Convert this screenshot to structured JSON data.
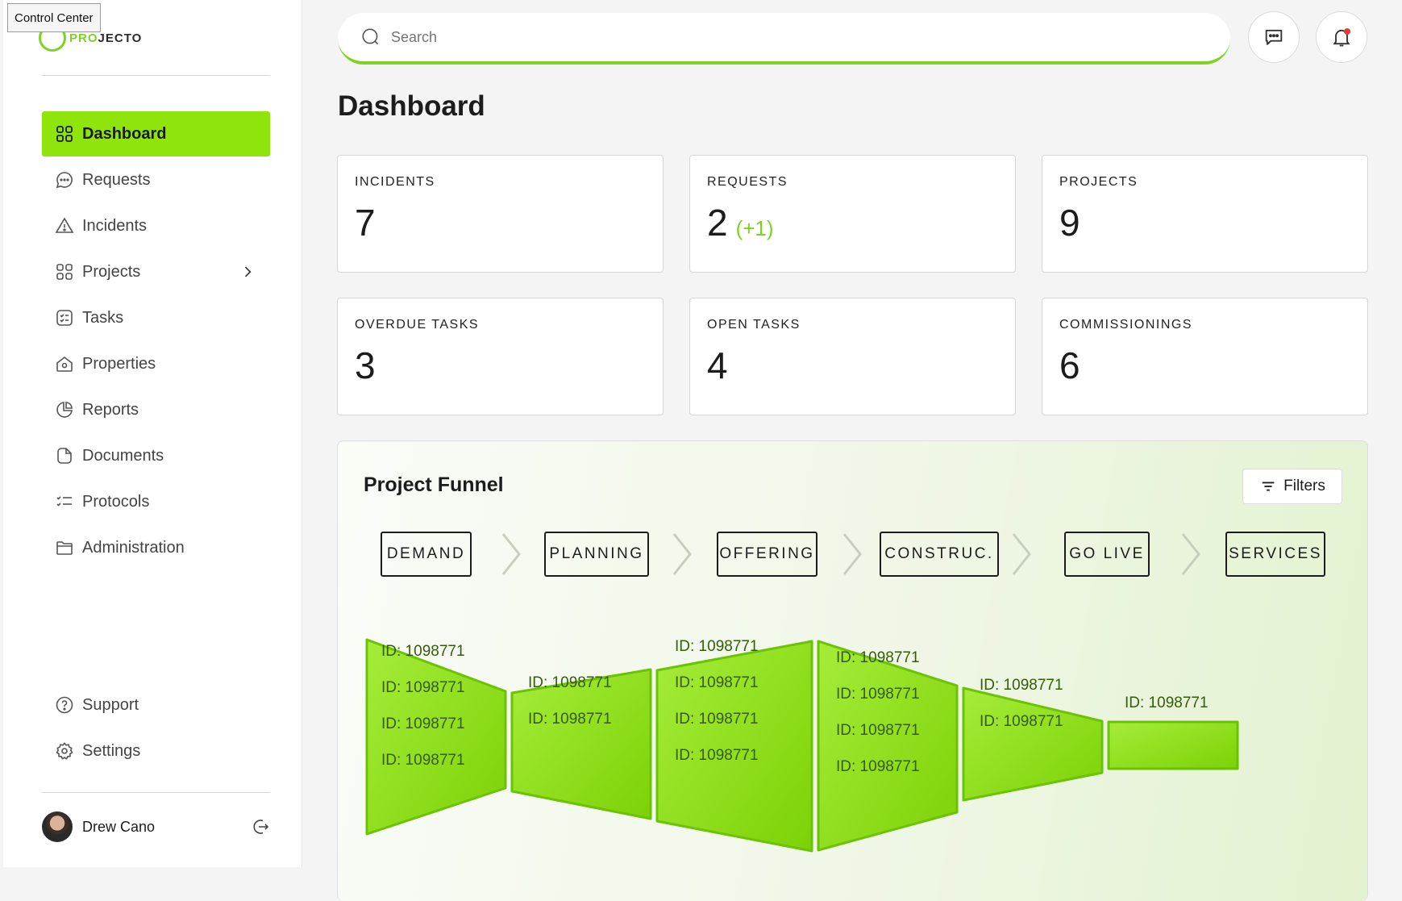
{
  "tooltip": "Control Center",
  "brand": {
    "pro": "PRO",
    "rest": "JECTO"
  },
  "nav": {
    "items": [
      {
        "label": "Dashboard",
        "icon": "grid-icon"
      },
      {
        "label": "Requests",
        "icon": "chat-icon"
      },
      {
        "label": "Incidents",
        "icon": "warning-icon"
      },
      {
        "label": "Projects",
        "icon": "grid-icon"
      },
      {
        "label": "Tasks",
        "icon": "checklist-icon"
      },
      {
        "label": "Properties",
        "icon": "house-icon"
      },
      {
        "label": "Reports",
        "icon": "pie-chart-icon"
      },
      {
        "label": "Documents",
        "icon": "document-icon"
      },
      {
        "label": "Protocols",
        "icon": "list-check-icon"
      },
      {
        "label": "Administration",
        "icon": "folder-icon"
      }
    ],
    "bottom": [
      {
        "label": "Support",
        "icon": "help-icon"
      },
      {
        "label": "Settings",
        "icon": "gear-icon"
      }
    ]
  },
  "user": {
    "name": "Drew Cano"
  },
  "search": {
    "placeholder": "Search"
  },
  "page": {
    "title": "Dashboard"
  },
  "stats": [
    {
      "label": "INCIDENTS",
      "value": "7",
      "delta": ""
    },
    {
      "label": "REQUESTS",
      "value": "2",
      "delta": "(+1)"
    },
    {
      "label": "PROJECTS",
      "value": "9",
      "delta": ""
    },
    {
      "label": "OVERDUE TASKS",
      "value": "3",
      "delta": ""
    },
    {
      "label": "OPEN TASKS",
      "value": "4",
      "delta": ""
    },
    {
      "label": "COMMISSIONINGS",
      "value": "6",
      "delta": ""
    }
  ],
  "funnel": {
    "title": "Project Funnel",
    "filters_label": "Filters",
    "stages": [
      "DEMAND",
      "PLANNING",
      "OFFERING",
      "CONSTRUC.",
      "GO LIVE",
      "SERVICES"
    ],
    "segments": [
      {
        "ids": [
          "ID: 1098771",
          "ID: 1098771",
          "ID: 1098771",
          "ID: 1098771"
        ]
      },
      {
        "ids": [
          "ID: 1098771",
          "ID: 1098771"
        ]
      },
      {
        "ids": [
          "ID: 1098771",
          "ID: 1098771",
          "ID: 1098771",
          "ID: 1098771"
        ]
      },
      {
        "ids": [
          "ID: 1098771",
          "ID: 1098771",
          "ID: 1098771",
          "ID: 1098771"
        ]
      },
      {
        "ids": [
          "ID: 1098771",
          "ID: 1098771"
        ]
      },
      {
        "ids": [
          "ID: 1098771"
        ]
      }
    ]
  },
  "colors": {
    "accent": "#8ee40b",
    "accent_dark": "#6cc204",
    "delta": "#7ed321"
  }
}
